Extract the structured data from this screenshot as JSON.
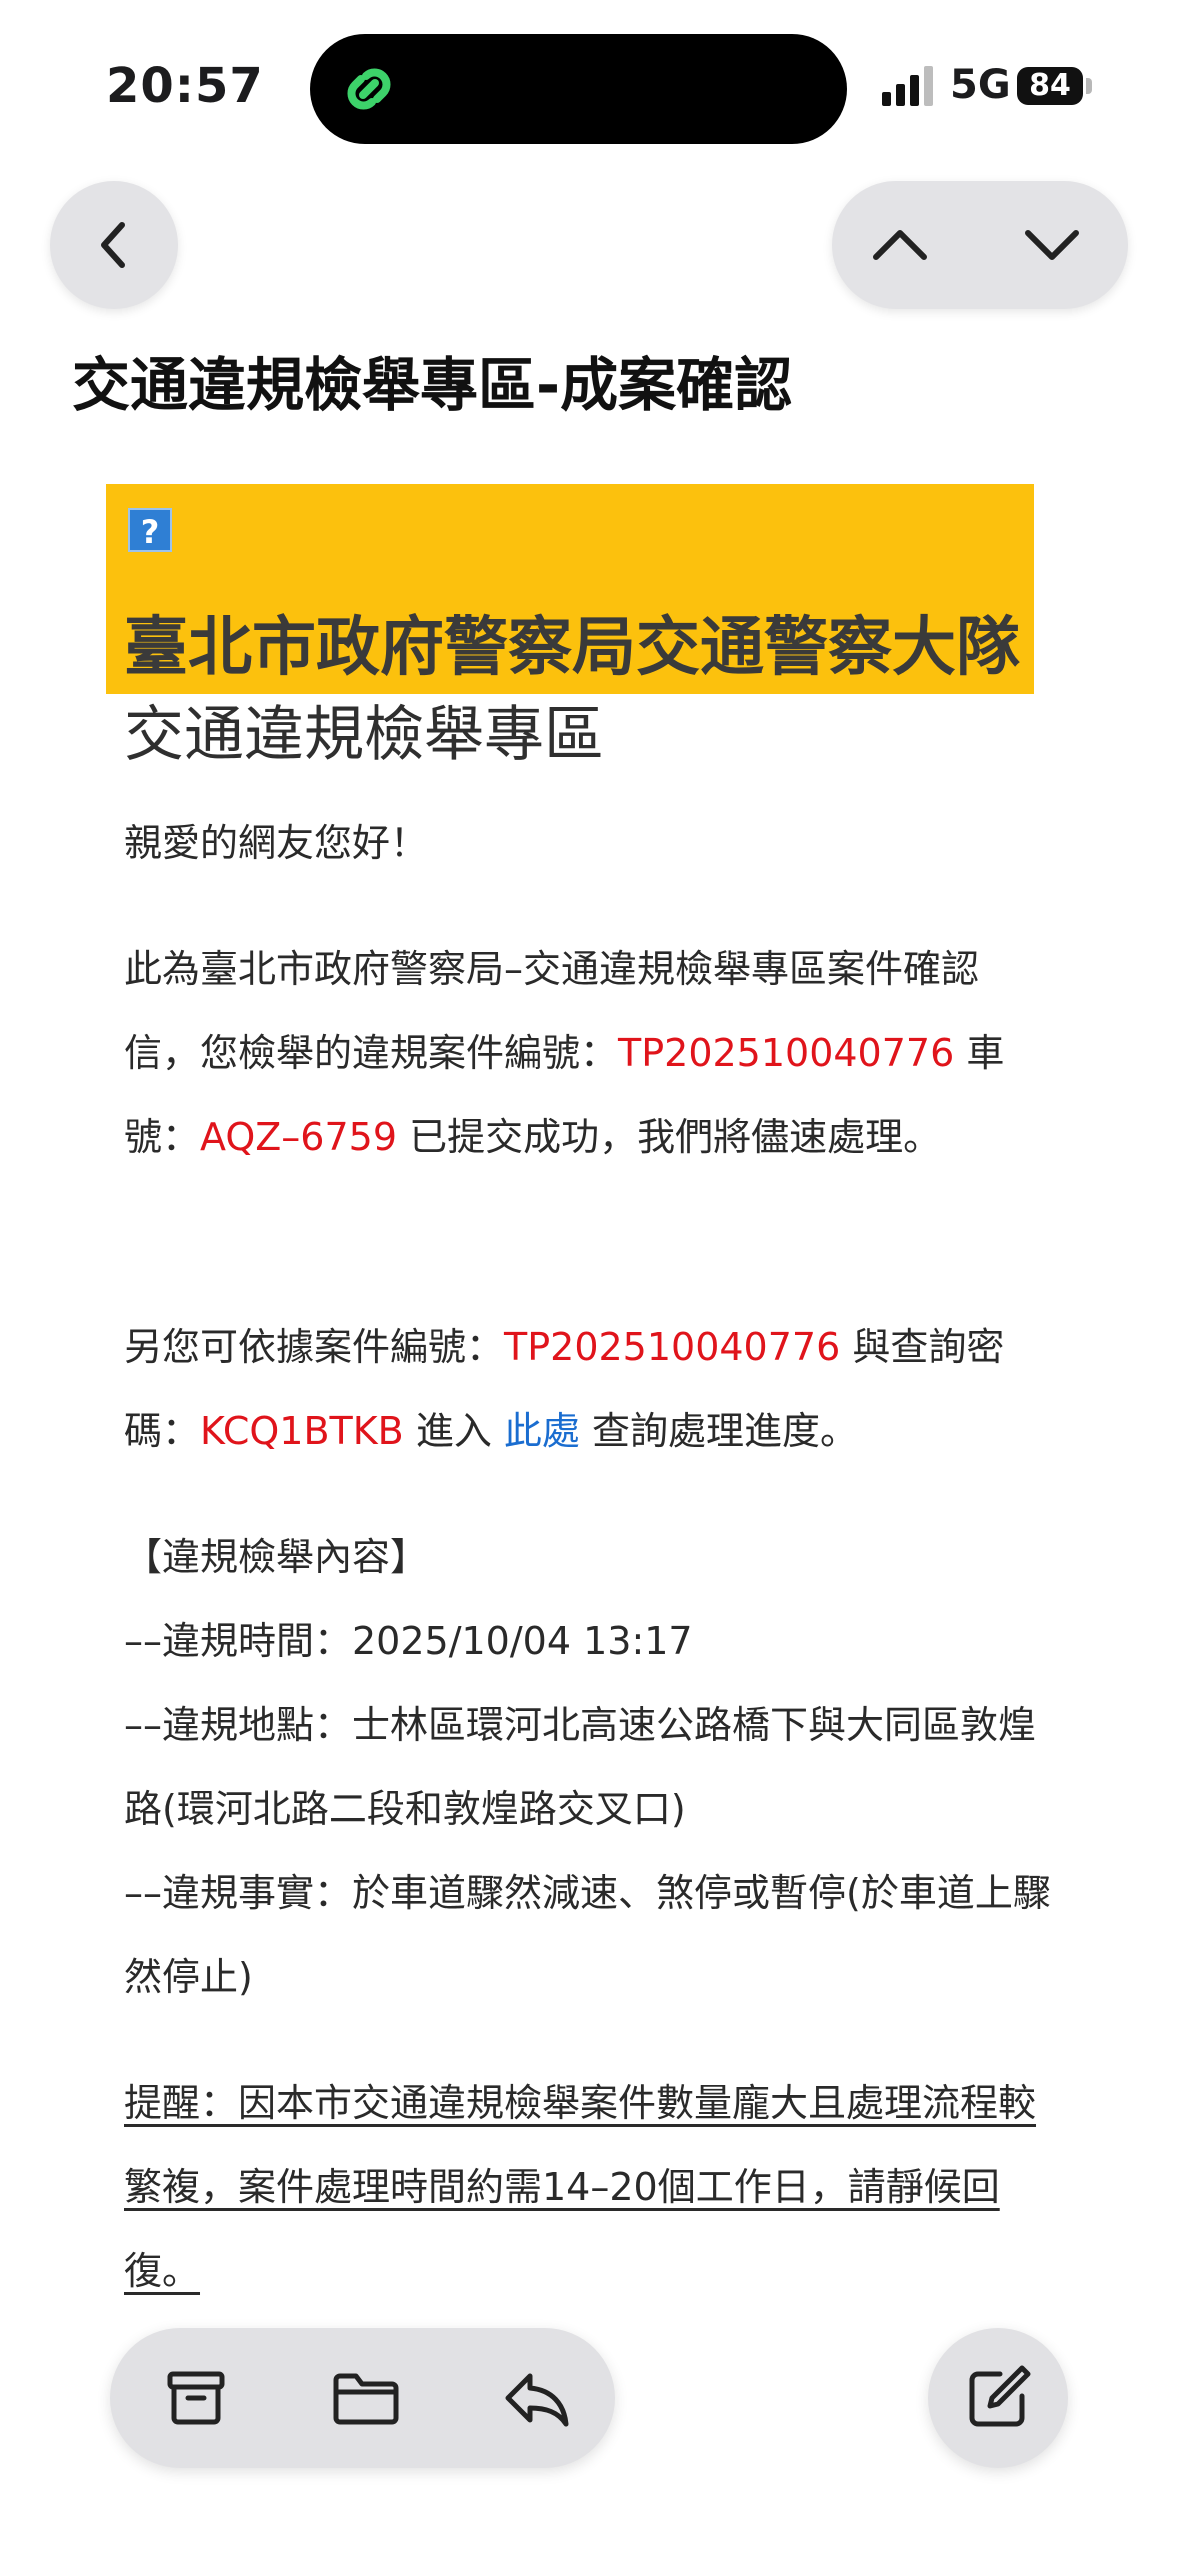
{
  "status": {
    "time": "20:57",
    "network": "5G",
    "battery": "84"
  },
  "nav": {
    "back_icon": "chevron-left-icon",
    "up_icon": "chevron-up-icon",
    "down_icon": "chevron-down-icon"
  },
  "subject": "交通違規檢舉專區-成案確認",
  "banner": {
    "broken_image": "?",
    "org": "臺北市政府警察局交通警察大隊",
    "zone": "交通違規檢舉專區"
  },
  "body": {
    "greeting": "親愛的網友您好！",
    "p1_a": "此為臺北市政府警察局–交通違規檢舉專區案件確認信，您檢舉的違規案件編號：",
    "case_no": "TP202510040776",
    "p1_b": " 車號：",
    "plate": "AQZ–6759",
    "p1_c": " 已提交成功，我們將儘速處理。",
    "p2_a": "另您可依據案件編號：",
    "p2_b": " 與查詢密碼：",
    "password": "KCQ1BTKB",
    "p2_c": " 進入 ",
    "link": "此處",
    "p2_d": " 查詢處理進度。",
    "section_title": "【違規檢舉內容】",
    "time_line": "––違規時間：2025/10/04 13:17",
    "place_line": "––違規地點：士林區環河北高速公路橋下與大同區敦煌路(環河北路二段和敦煌路交叉口)",
    "fact_line": "––違規事實：於車道驟然減速、煞停或暫停(於車道上驟然停止)",
    "reminder": "提醒：因本市交通違規檢舉案件數量龐大且處理流程較繁複，案件處理時間約需14–20個工作日，請靜候回復。"
  },
  "toolbar": {
    "archive_icon": "archive-icon",
    "folder_icon": "folder-icon",
    "reply_icon": "reply-icon",
    "compose_icon": "compose-icon"
  },
  "colors": {
    "banner": "#fcc10d",
    "highlight": "#e0141b",
    "link": "#1a6dd0"
  }
}
